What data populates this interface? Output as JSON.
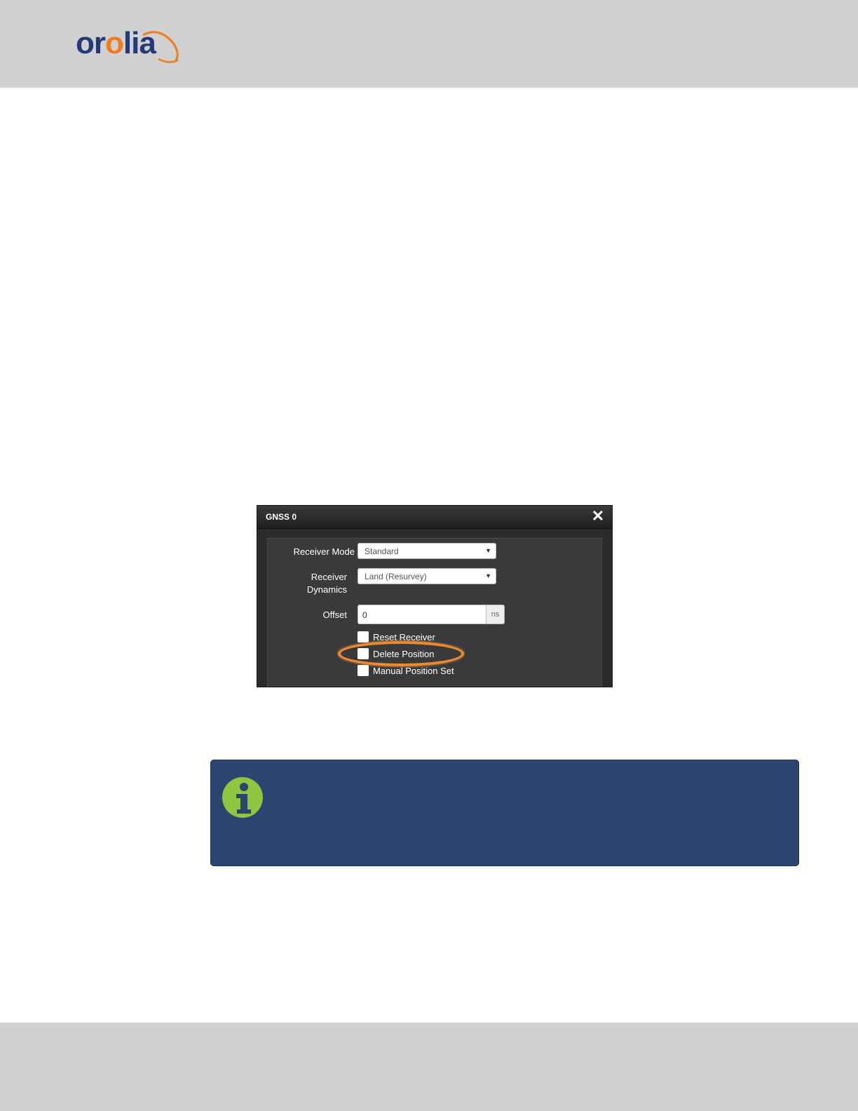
{
  "logo": {
    "text_before": "or",
    "text_o": "o",
    "text_after": "lia"
  },
  "dialog": {
    "title": "GNSS 0",
    "close_glyph": "✕",
    "receiver_mode": {
      "label": "Receiver Mode",
      "selected": "Standard"
    },
    "receiver_dynamics": {
      "label_line1": "Receiver",
      "label_line2": "Dynamics",
      "selected": "Land (Resurvey)"
    },
    "offset": {
      "label": "Offset",
      "value": "0",
      "unit": "ns"
    },
    "checkboxes": [
      {
        "label": "Reset Receiver",
        "checked": false
      },
      {
        "label": "Delete Position",
        "checked": false
      },
      {
        "label": "Manual Position Set",
        "checked": false
      }
    ],
    "dropdown_glyph": "▼"
  },
  "note": {
    "icon": "info-icon",
    "icon_color": "#8dc63f"
  },
  "colors": {
    "header_bg": "#d0d0d0",
    "note_bg": "#2e4470",
    "highlight": "#ef8a2a",
    "brand_blue": "#22397a",
    "brand_orange": "#ef7d1a"
  }
}
